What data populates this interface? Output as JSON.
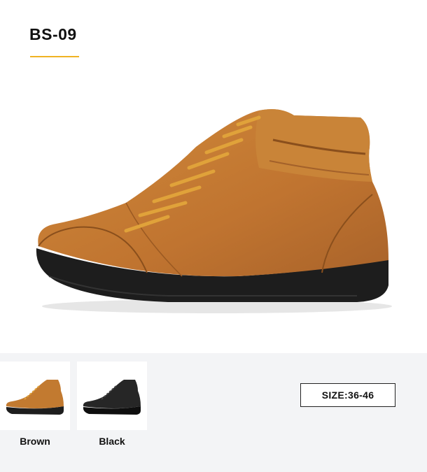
{
  "product": {
    "model": "BS-09",
    "accent_color": "#f0b323"
  },
  "variants": [
    {
      "label": "Brown",
      "color": "#c27a30"
    },
    {
      "label": "Black",
      "color": "#1c1c1c"
    }
  ],
  "size": {
    "label": "SIZE:36-46"
  }
}
